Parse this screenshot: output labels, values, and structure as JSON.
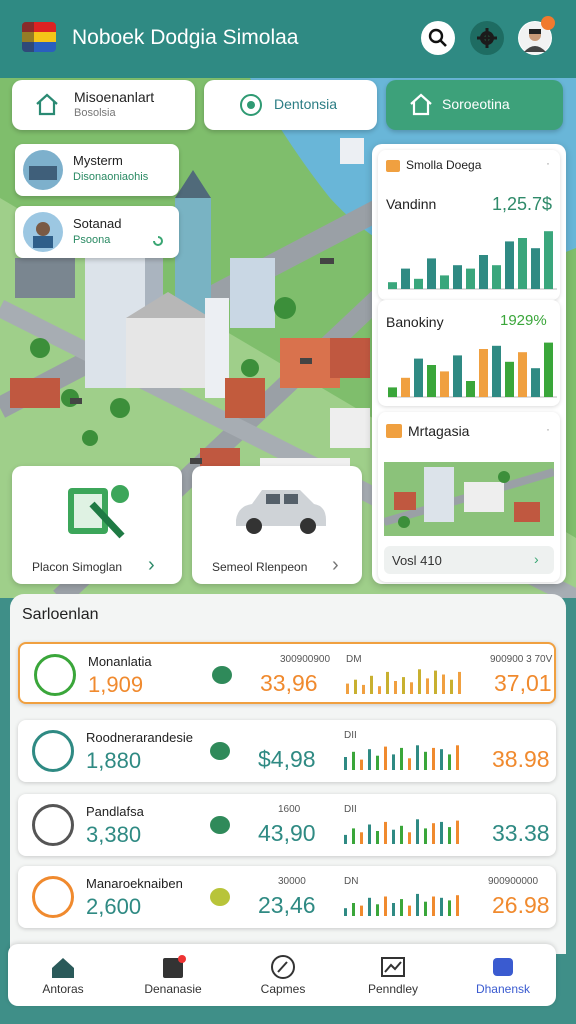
{
  "header": {
    "title": "Noboek Dodgia Simolaa",
    "colors": {
      "bar": "#2f8a83",
      "accent_green": "#3aa673",
      "accent_orange": "#f0a040"
    }
  },
  "nav_cards": [
    {
      "title": "Misoenanlart",
      "subtitle": "Bosolsia",
      "icon": "home-icon"
    },
    {
      "title": "Dentonsia",
      "icon": "target-icon"
    },
    {
      "title": "Soroeotina",
      "icon": "home-outline-icon"
    }
  ],
  "mini_cards": [
    {
      "title": "Mysterm",
      "subtitle": "Disonaoniaohis"
    },
    {
      "title": "Sotanad",
      "subtitle": "Psoona"
    }
  ],
  "right_panel": {
    "header": "Smolla Doega",
    "chart1": {
      "label": "Vandinn",
      "value": "1,25.7$"
    },
    "chart2": {
      "label": "Banokiny",
      "value": "1929%"
    },
    "map_label": "Mrtagasia",
    "footer_value": "Vosl 410"
  },
  "chart_data": [
    {
      "type": "bar",
      "series": [
        {
          "values": [
            0.1,
            0.3,
            0.15,
            0.45,
            0.2,
            0.35,
            0.3,
            0.5,
            0.35,
            0.7,
            0.75,
            0.6,
            0.85
          ]
        }
      ]
    },
    {
      "type": "bar",
      "series": [
        {
          "values": [
            0.15,
            0.3,
            0.6,
            0.5,
            0.4,
            0.65,
            0.25,
            0.75,
            0.8,
            0.55,
            0.7,
            0.45,
            0.85
          ]
        }
      ]
    }
  ],
  "city_cards": [
    {
      "label": "Placon Simoglan",
      "icon": "tools-icon"
    },
    {
      "label": "Semeol Rlenpeon",
      "icon": "car-image"
    }
  ],
  "stats": {
    "title": "Sarloenlan",
    "rows": [
      {
        "name": "Monanlatia",
        "value": "1,909",
        "sub1": "300900900",
        "sub2": "DM",
        "amount": "33,96",
        "sub3": "900900 3 70V",
        "right": "37,01",
        "icon": "document-icon",
        "highlight": true,
        "bars": [
          0.4,
          0.55,
          0.35,
          0.7,
          0.3,
          0.85,
          0.5,
          0.65,
          0.45,
          0.95,
          0.6,
          0.9,
          0.75,
          0.55,
          0.85
        ]
      },
      {
        "name": "Roodnerarandesie",
        "value": "1,880",
        "sub1": "",
        "sub2": "DII",
        "amount": "$4,98",
        "sub3": "",
        "right": "38.98",
        "icon": "plant-icon",
        "highlight": false,
        "bars": [
          0.5,
          0.7,
          0.4,
          0.8,
          0.55,
          0.9,
          0.6,
          0.85,
          0.45,
          0.95,
          0.7,
          0.85,
          0.8,
          0.6,
          0.95
        ]
      },
      {
        "name": "Pandlafsa",
        "value": "3,380",
        "sub1": "1600",
        "sub2": "DII",
        "amount": "43,90",
        "sub3": "",
        "right": "33.38",
        "icon": "building-icon",
        "highlight": false,
        "bars": [
          0.35,
          0.6,
          0.45,
          0.75,
          0.5,
          0.85,
          0.55,
          0.7,
          0.45,
          0.95,
          0.6,
          0.8,
          0.85,
          0.65,
          0.9
        ]
      },
      {
        "name": "Manaroeknaiben",
        "value": "2,600",
        "sub1": "30000",
        "sub2": "DN",
        "amount": "23,46",
        "sub3": "900900000",
        "right": "26.98",
        "icon": "card-icon",
        "highlight": false,
        "bars": [
          0.3,
          0.5,
          0.4,
          0.7,
          0.45,
          0.75,
          0.5,
          0.65,
          0.4,
          0.85,
          0.55,
          0.75,
          0.7,
          0.6,
          0.8
        ]
      }
    ]
  },
  "tabs": [
    {
      "label": "Antoras",
      "icon": "home-icon"
    },
    {
      "label": "Denanasie",
      "icon": "document-icon"
    },
    {
      "label": "Capmes",
      "icon": "compass-icon"
    },
    {
      "label": "Penndley",
      "icon": "chart-icon"
    },
    {
      "label": "Dhanensk",
      "icon": "wallet-icon"
    }
  ]
}
